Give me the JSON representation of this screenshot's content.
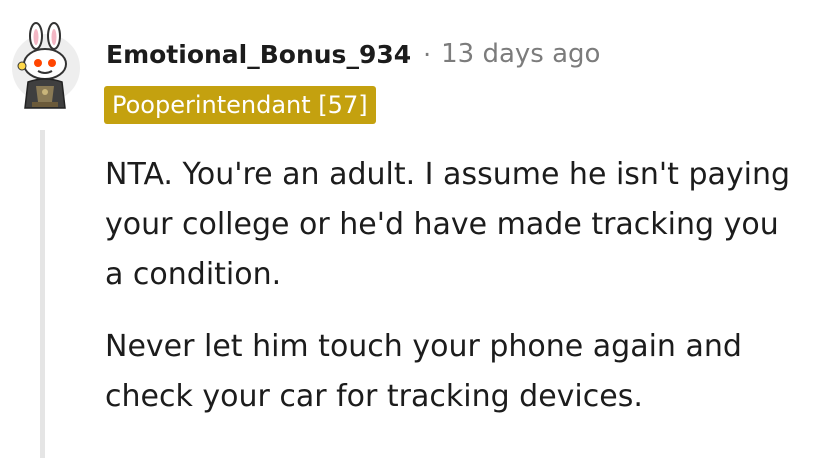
{
  "comment": {
    "author": "Emotional_Bonus_934",
    "separator": "·",
    "timestamp": "13 days ago",
    "flair": "Pooperintendant [57]",
    "paragraphs": [
      "NTA. You're an adult. I assume he isn't paying your college or he'd have made tracking you a condition.",
      "Never let him touch your phone again and check your car for tracking devices."
    ]
  },
  "colors": {
    "flair_bg": "#c4a10f",
    "thread_line": "#e5e5e5",
    "text": "#1c1c1c",
    "muted": "#7c7c7c"
  },
  "icons": {
    "avatar": "snoo-bunny-avatar-icon"
  }
}
